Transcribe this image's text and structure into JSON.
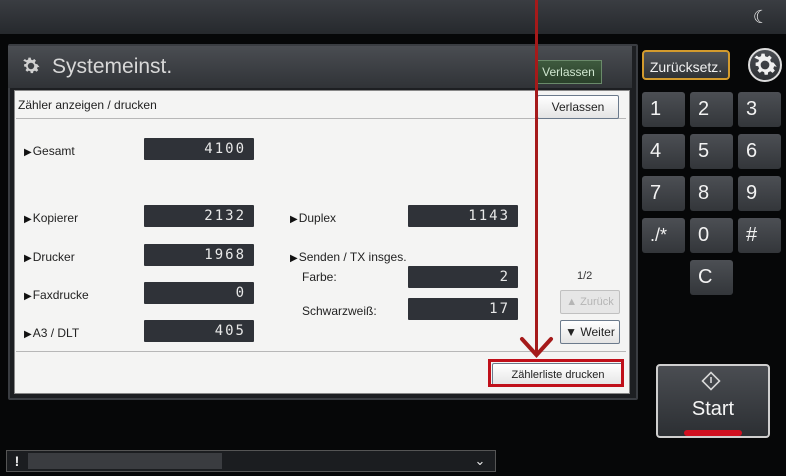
{
  "header": {
    "title": "Systemeinst.",
    "exit_label": "Verlassen"
  },
  "sub": {
    "title": "Zähler anzeigen / drucken",
    "exit_label": "Verlassen"
  },
  "counters": {
    "total": {
      "label": "Gesamt",
      "value": "4100"
    },
    "copier": {
      "label": "Kopierer",
      "value": "2132"
    },
    "printer": {
      "label": "Drucker",
      "value": "1968"
    },
    "fax": {
      "label": "Faxdrucke",
      "value": "0"
    },
    "a3": {
      "label": "A3 / DLT",
      "value": "405"
    },
    "duplex": {
      "label": "Duplex",
      "value": "1143"
    },
    "send": {
      "label": "Senden / TX insges."
    },
    "color": {
      "label": "Farbe:",
      "value": "2"
    },
    "bw": {
      "label": "Schwarzweiß:",
      "value": "17"
    }
  },
  "pagination": {
    "page": "1/2",
    "back_label": "Zurück",
    "next_label": "Weiter"
  },
  "print_list_label": "Zählerliste drucken",
  "side": {
    "reset_label": "Zurücksetz.",
    "keys": [
      "1",
      "2",
      "3",
      "4",
      "5",
      "6",
      "7",
      "8",
      "9",
      "./*",
      "0",
      "#",
      "C"
    ],
    "start_label": "Start"
  },
  "colors": {
    "highlight": "#c0101a",
    "arrow": "#a51a1a",
    "reset_border": "#d39b2d",
    "start_accent": "#d01020"
  },
  "icons": [
    "moon-icon",
    "gear-icon",
    "warning-icon",
    "chevron-down-icon",
    "start-diamond-icon",
    "triangle-right-icon"
  ]
}
